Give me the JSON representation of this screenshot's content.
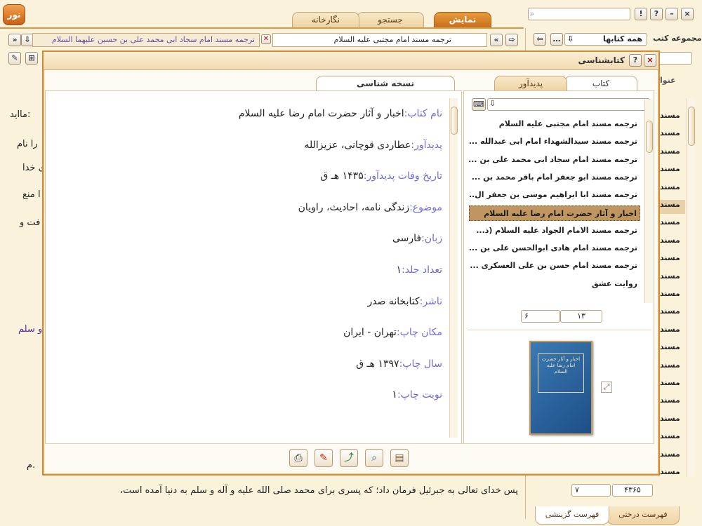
{
  "app": {
    "logo_text": "نور"
  },
  "top_tabs": [
    {
      "label": "نمایش"
    },
    {
      "label": "جستجو"
    },
    {
      "label": "نگارخانه"
    }
  ],
  "search": {
    "placeholder": ""
  },
  "win_buttons": {
    "info": "!",
    "help": "?",
    "min": "–",
    "close": "×"
  },
  "collections": {
    "label": "مجموعه کتب",
    "value": "همه کتابها"
  },
  "doc_tabs": [
    {
      "label": "ترجمه مسند امام مجتبی علیه السلام"
    },
    {
      "label": "ترجمه مسند امام سجاد ابی محمد علی بن حسین علیهما السلام"
    }
  ],
  "background": {
    "line1": "مااید:",
    "line2": "را نام",
    "line3": "ی خدا",
    "line4": "ا منع",
    "line5": "فت و",
    "line6": "و سلم",
    "line7": "م.",
    "line8": "پس خدای تعالی به جبرئیل فرمان داد؛ که پسری برای محمد صلی الله علیه و آله و سلم به دنیا آمده است،",
    "right_header": "عنوا",
    "right_items": [
      "مسند",
      "مسند",
      "مسند",
      "مسند",
      "مسند",
      "مسند",
      "مسند",
      "مسند",
      "مسند",
      "مسند",
      "مسند",
      "مسند",
      "مسند",
      "مسند",
      "مسند",
      "مسند",
      "مسند",
      "مسند",
      "مسند",
      "مسند",
      "مسند"
    ],
    "pager_right": "۴۳۶۵",
    "pager_left": "۷",
    "bottom_tabs": [
      {
        "label": "فهرست درختی"
      },
      {
        "label": "فهرست گزینشی"
      }
    ]
  },
  "dialog": {
    "title": "کتابشناسی",
    "left_tab": "نسخه شناسی",
    "right_tabs": [
      {
        "label": "کتاب"
      },
      {
        "label": "پدیدآور"
      }
    ],
    "fields": [
      {
        "label": "نام کتاب:",
        "value": "اخبار و آثار حضرت امام رضا علیه السلام"
      },
      {
        "label": "پدیدآور:",
        "value": "عطاردی قوچانی، عزیزالله"
      },
      {
        "label": "تاریخ وفات پدیدآور:",
        "value": "۱۴۳۵ هـ ق"
      },
      {
        "label": "موضوع:",
        "value": "زندگی نامه، احادیث، راویان"
      },
      {
        "label": "زبان:",
        "value": "فارسی"
      },
      {
        "label": "تعداد جلد:",
        "value": "۱"
      },
      {
        "label": "ناشر:",
        "value": "کتابخانه صدر"
      },
      {
        "label": "مکان چاپ:",
        "value": "تهران - ایران"
      },
      {
        "label": "سال چاپ:",
        "value": "۱۳۹۷ هـ ق"
      },
      {
        "label": "نوبت چاپ:",
        "value": "۱"
      }
    ],
    "book_list": [
      {
        "title": "ترجمه مسند امام مجتبی علیه السلام",
        "selected": false
      },
      {
        "title": "ترجمه مسند سیدالشهداء امام ابی عبدالله ...",
        "selected": false
      },
      {
        "title": "ترجمه مسند امام سجاد ابی محمد علی بن ...",
        "selected": false
      },
      {
        "title": "ترجمه مسند ابو جعفر امام باقر محمد بن ...",
        "selected": false
      },
      {
        "title": "ترجمه مسند ابا ابراهیم موسی بن جعفر ال...",
        "selected": false
      },
      {
        "title": "اخبار و آثار حضرت امام رضا علیه السلام",
        "selected": true
      },
      {
        "title": "ترجمه مسند الامام الجواد علیه السلام (ذ...",
        "selected": false
      },
      {
        "title": "ترجمه مسند امام هادی ابوالحسن علی بن ...",
        "selected": false
      },
      {
        "title": "ترجمه مسند امام حسن بن علی العسکری ...",
        "selected": false
      },
      {
        "title": "روایت عشق",
        "selected": false
      }
    ],
    "pager": {
      "total": "۱۳",
      "current": "۶"
    },
    "cover_text": "اخبار و آثار حضرت امام رضا علیه السلام",
    "toolbar_icons": [
      {
        "name": "print-icon"
      },
      {
        "name": "edit-icon"
      },
      {
        "name": "export-icon"
      },
      {
        "name": "zoom-icon"
      },
      {
        "name": "document-icon"
      }
    ]
  }
}
